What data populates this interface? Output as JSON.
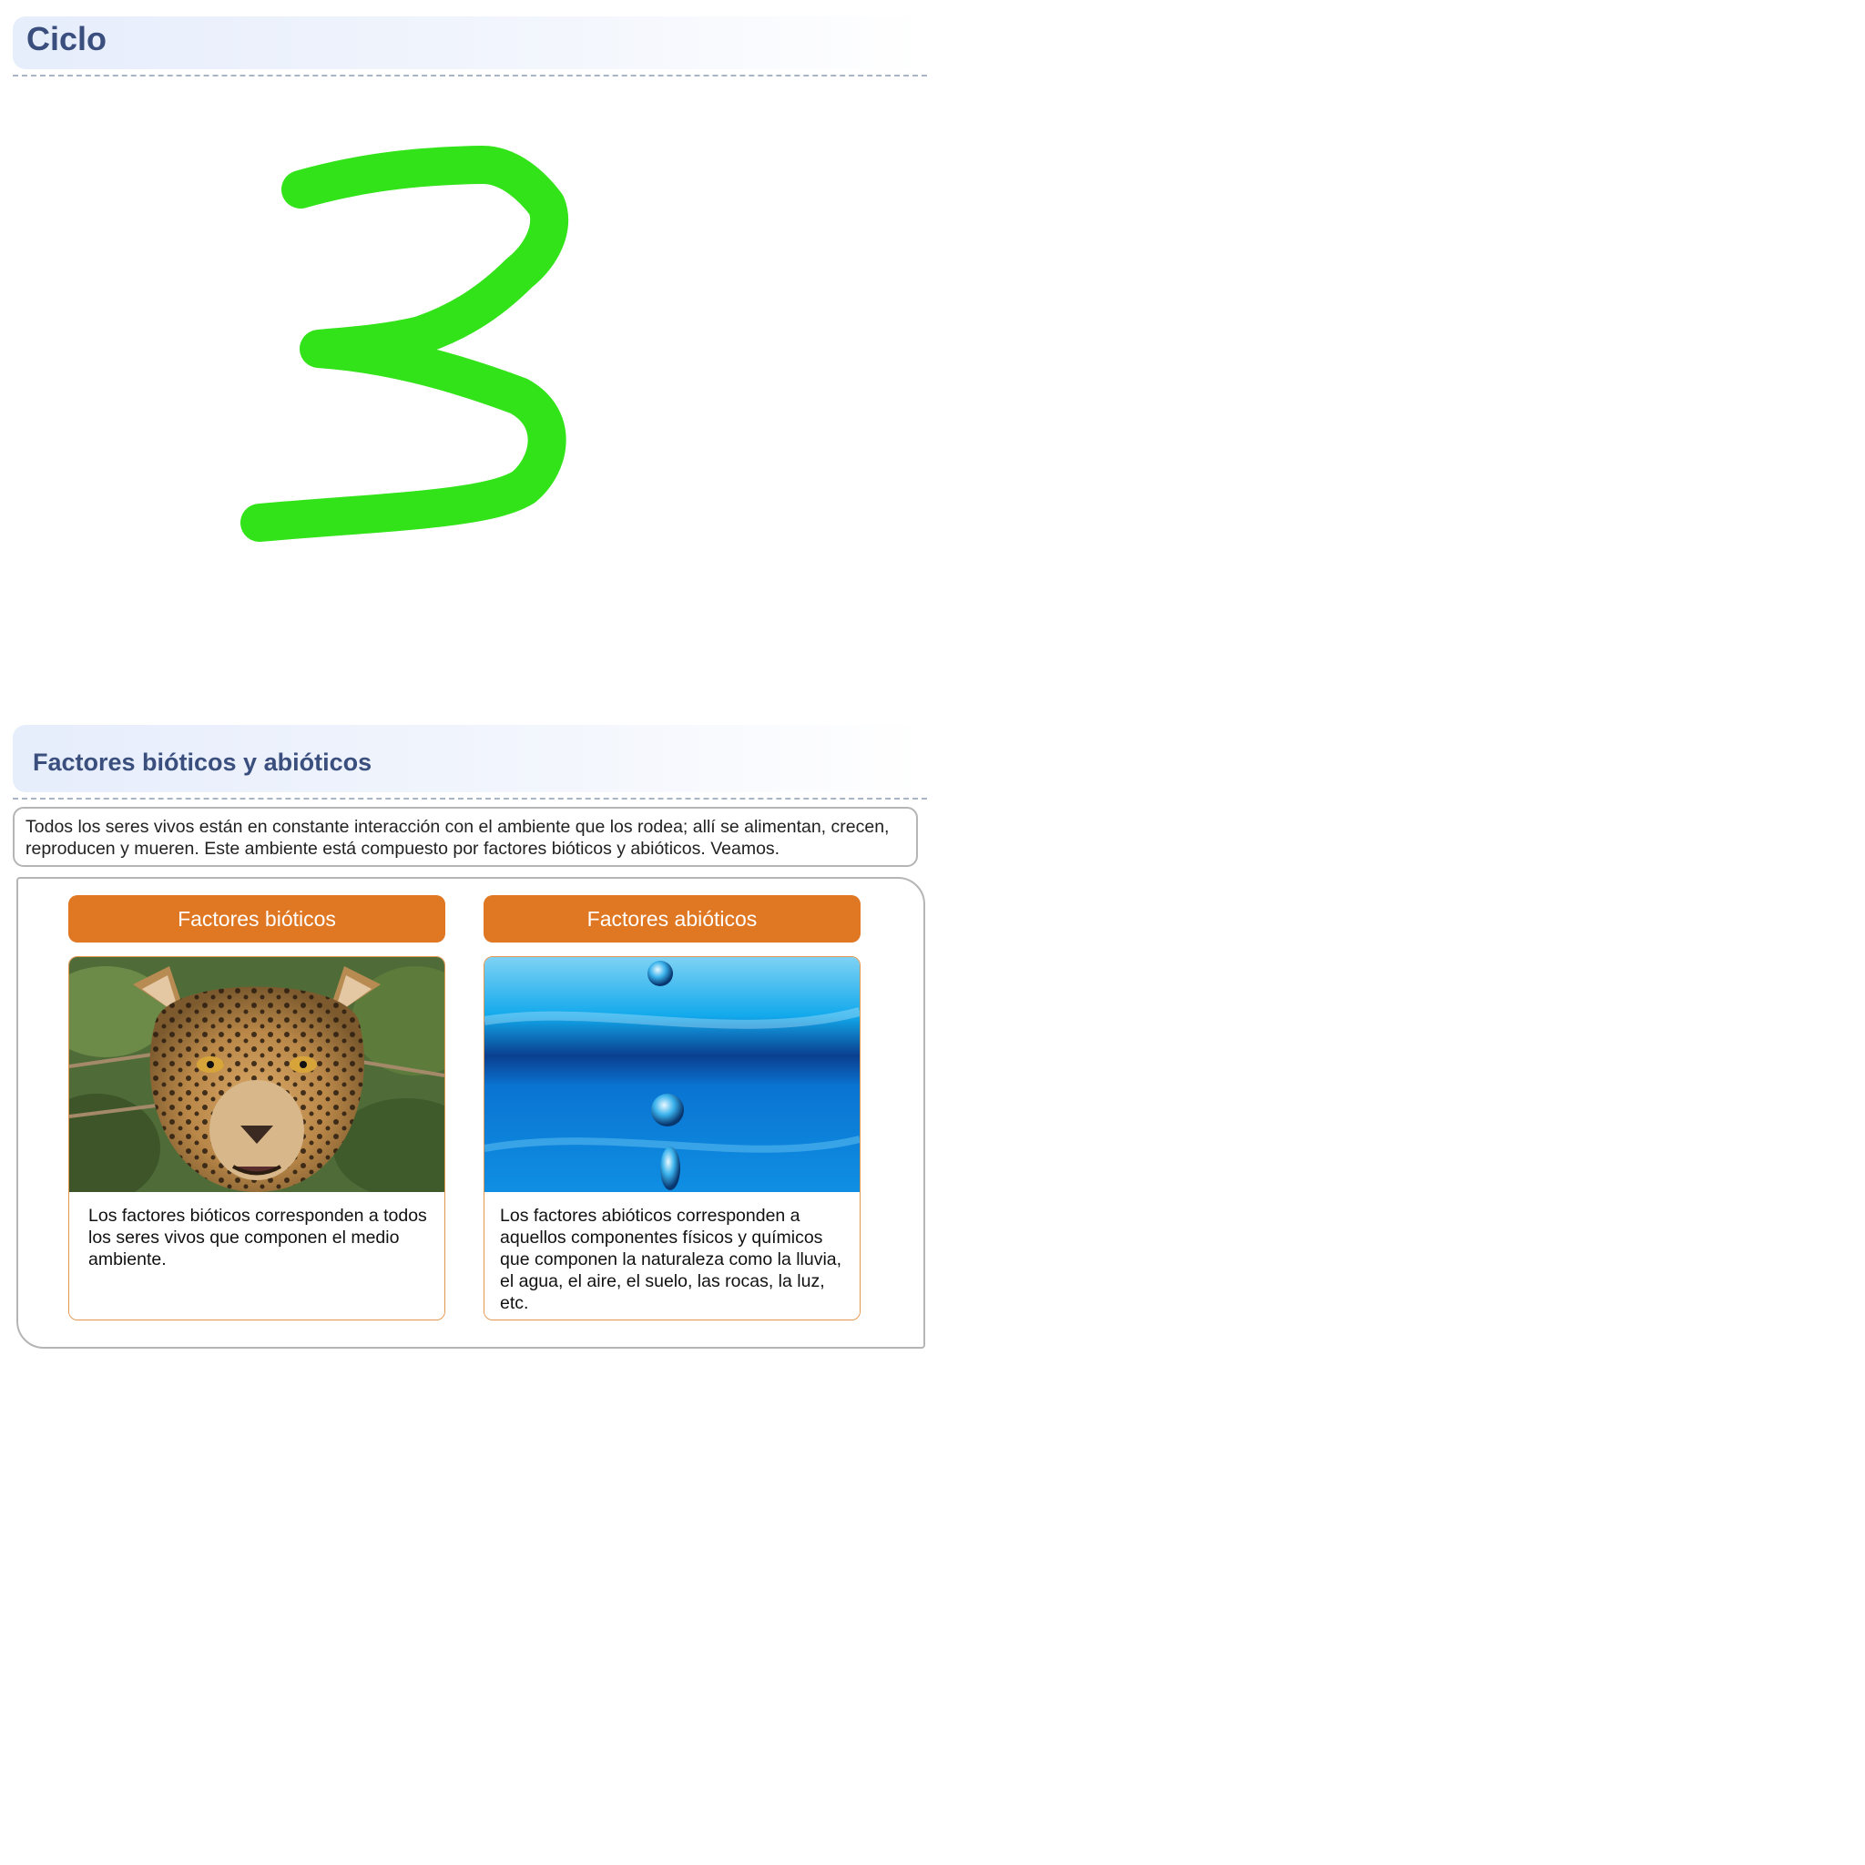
{
  "header": {
    "title": "Ciclo"
  },
  "scribble": {
    "glyph": "3",
    "color": "#33e31a"
  },
  "section": {
    "title": "Factores bióticos y abióticos",
    "intro": "Todos los seres vivos están en constante interacción con el ambiente que los rodea; allí se alimentan, crecen, reproducen y mueren. Este ambiente está compuesto por factores bióticos y abióticos. Veamos."
  },
  "tabs": [
    {
      "label": "Factores bióticos"
    },
    {
      "label": "Factores abióticos"
    }
  ],
  "cards": [
    {
      "image": "leopard-photo",
      "text": "Los factores bióticos corresponden a todos los seres vivos que componen el medio ambiente."
    },
    {
      "image": "water-drops-photo",
      "text": "Los factores abióticos corresponden a aquellos componentes físicos y químicos que componen la naturaleza como la lluvia, el agua, el aire, el suelo, las rocas, la luz, etc."
    }
  ],
  "colors": {
    "heading": "#3a4f7e",
    "accent": "#e07722",
    "border": "#b5b5b5"
  }
}
